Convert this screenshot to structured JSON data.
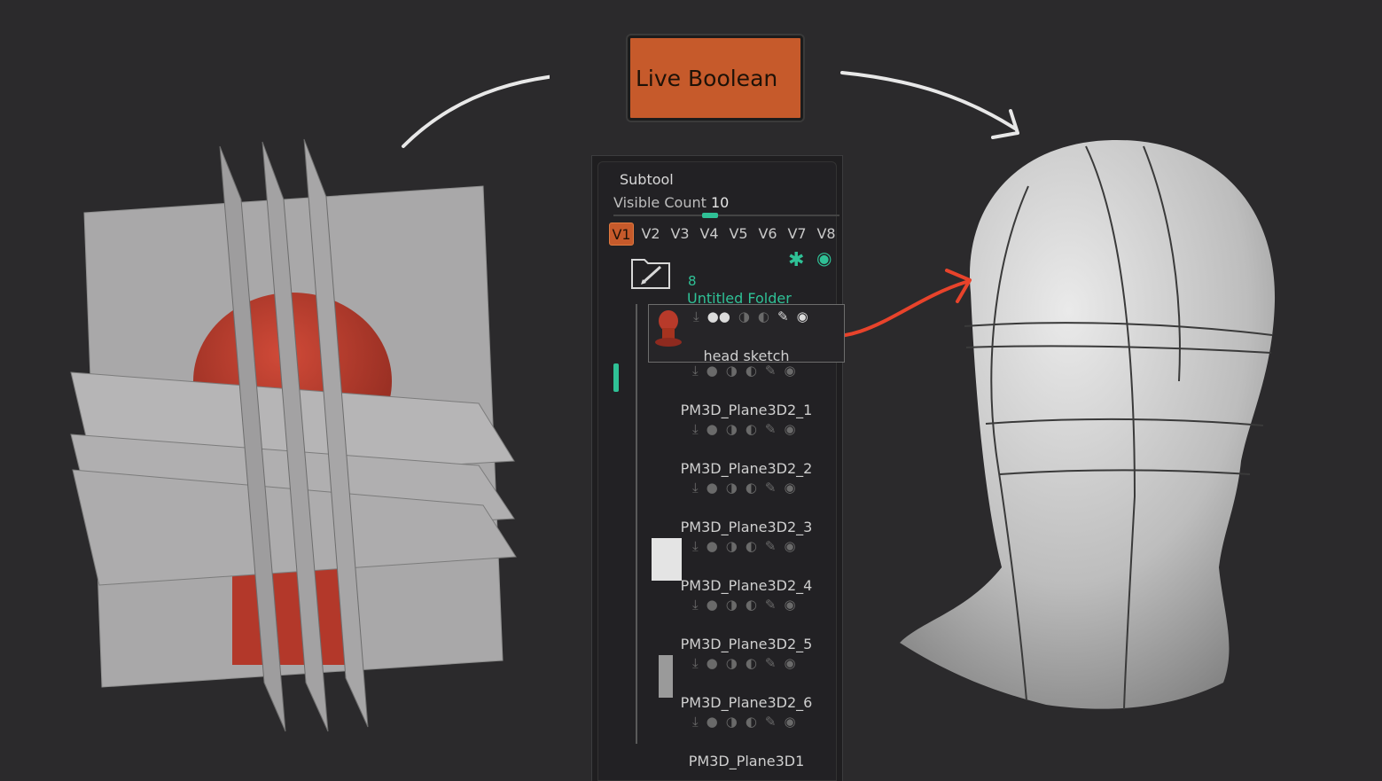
{
  "button": {
    "label": "Live Boolean"
  },
  "subtool": {
    "title": "Subtool",
    "visible_count_label": "Visible Count",
    "visible_count_value": "10",
    "tabs": [
      "V1",
      "V2",
      "V3",
      "V4",
      "V5",
      "V6",
      "V7",
      "V8"
    ],
    "active_tab": "V1",
    "folder": {
      "count": "8",
      "name": "Untitled Folder"
    },
    "items": [
      {
        "name": "head sketch",
        "selected": true
      },
      {
        "name": "PM3D_Plane3D2_1"
      },
      {
        "name": "PM3D_Plane3D2_2"
      },
      {
        "name": "PM3D_Plane3D2_3"
      },
      {
        "name": "PM3D_Plane3D2_4"
      },
      {
        "name": "PM3D_Plane3D2_5"
      },
      {
        "name": "PM3D_Plane3D2_6"
      },
      {
        "name": "PM3D_Plane3D1"
      }
    ]
  },
  "colors": {
    "accent": "#2fc196",
    "button": "#c65a2b",
    "red_model": "#b83a2a",
    "arrow_red": "#e8432b"
  },
  "icons": [
    "arrow-right-icon",
    "gear-icon",
    "eye-icon",
    "folder-icon",
    "move-down-icon",
    "toggle-icon",
    "brush-icon"
  ]
}
